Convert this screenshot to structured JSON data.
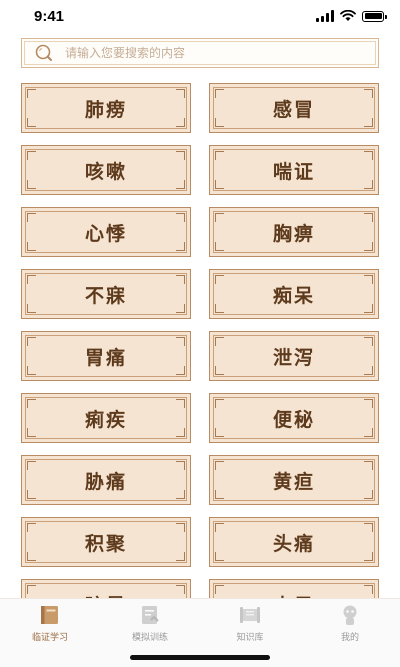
{
  "status_bar": {
    "time": "9:41"
  },
  "search": {
    "placeholder": "请输入您要搜索的内容"
  },
  "cards": [
    "肺痨",
    "感冒",
    "咳嗽",
    "喘证",
    "心悸",
    "胸痹",
    "不寐",
    "痴呆",
    "胃痛",
    "泄泻",
    "痢疾",
    "便秘",
    "胁痛",
    "黄疸",
    "积聚",
    "头痛",
    "眩晕",
    "中风"
  ],
  "tabbar": {
    "tabs": [
      {
        "label": "临证学习",
        "icon": "book-icon",
        "active": true
      },
      {
        "label": "模拟训练",
        "icon": "clipboard-icon",
        "active": false
      },
      {
        "label": "知识库",
        "icon": "scroll-icon",
        "active": false
      },
      {
        "label": "我的",
        "icon": "person-icon",
        "active": false
      }
    ]
  },
  "colors": {
    "accent": "#9a6a3e",
    "card_bg": "#f4e4d1",
    "card_border": "#b98b63",
    "text": "#5e3a1d"
  }
}
